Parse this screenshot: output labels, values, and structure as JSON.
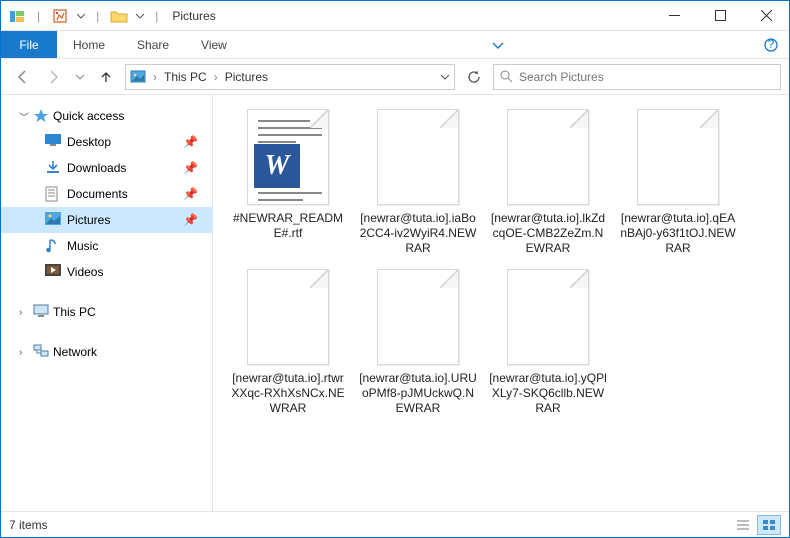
{
  "titlebar": {
    "title": "Pictures"
  },
  "ribbon": {
    "file": "File",
    "tabs": [
      "Home",
      "Share",
      "View"
    ]
  },
  "breadcrumb": {
    "root": "This PC",
    "current": "Pictures"
  },
  "search": {
    "placeholder": "Search Pictures"
  },
  "sidebar": {
    "quick_access": "Quick access",
    "items": [
      {
        "label": "Desktop"
      },
      {
        "label": "Downloads"
      },
      {
        "label": "Documents"
      },
      {
        "label": "Pictures"
      },
      {
        "label": "Music"
      },
      {
        "label": "Videos"
      }
    ],
    "this_pc": "This PC",
    "network": "Network"
  },
  "files": [
    {
      "name": "#NEWRAR_README#.rtf",
      "type": "rtf"
    },
    {
      "name": "[newrar@tuta.io].iaBo2CC4-iv2WyiR4.NEWRAR",
      "type": "blank"
    },
    {
      "name": "[newrar@tuta.io].lkZdcqOE-CMB2ZeZm.NEWRAR",
      "type": "blank"
    },
    {
      "name": "[newrar@tuta.io].qEAnBAj0-y63f1tOJ.NEWRAR",
      "type": "blank"
    },
    {
      "name": "[newrar@tuta.io].rtwrXXqc-RXhXsNCx.NEWRAR",
      "type": "blank"
    },
    {
      "name": "[newrar@tuta.io].URUoPMf8-pJMUckwQ.NEWRAR",
      "type": "blank"
    },
    {
      "name": "[newrar@tuta.io].yQPlXLy7-SKQ6cllb.NEWRAR",
      "type": "blank"
    }
  ],
  "status": {
    "count": "7 items"
  }
}
